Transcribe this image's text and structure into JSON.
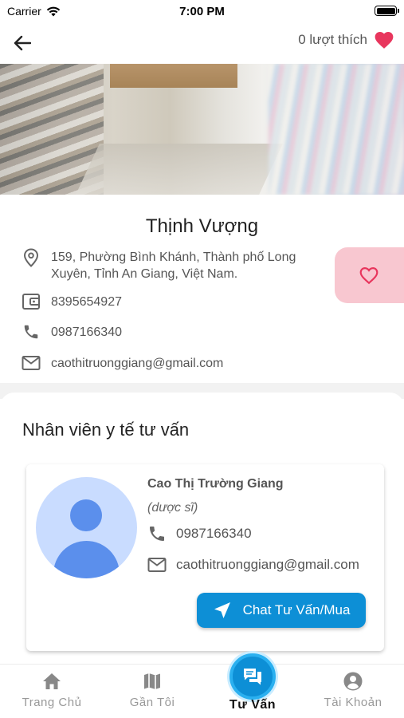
{
  "status_bar": {
    "carrier": "Carrier",
    "time": "7:00 PM"
  },
  "header": {
    "likes_label": "0 lượt thích"
  },
  "shop": {
    "name": "Thịnh Vượng",
    "address": "159, Phường Bình Khánh, Thành phố Long Xuyên, Tỉnh An Giang, Việt Nam.",
    "tax_code": "8395654927",
    "phone": "0987166340",
    "email": "caothitruonggiang@gmail.com"
  },
  "consult_section": {
    "title": "Nhân viên y tế tư vấn",
    "staff": {
      "name": "Cao Thị Trường Giang",
      "role": "(dược sĩ)",
      "phone": "0987166340",
      "email": "caothitruonggiang@gmail.com",
      "chat_button": "Chat Tư Vấn/Mua"
    }
  },
  "tabs": [
    {
      "label": "Trang Chủ",
      "icon": "home-icon"
    },
    {
      "label": "Gần Tôi",
      "icon": "map-icon"
    },
    {
      "label": "Tư Vấn",
      "icon": "chat-icon",
      "active": true
    },
    {
      "label": "Tài Khoản",
      "icon": "account-icon"
    }
  ],
  "colors": {
    "accent": "#0d8fd6",
    "heart": "#e8365d",
    "fav_bg": "#f8c7d0",
    "tab_inactive": "#999999"
  }
}
